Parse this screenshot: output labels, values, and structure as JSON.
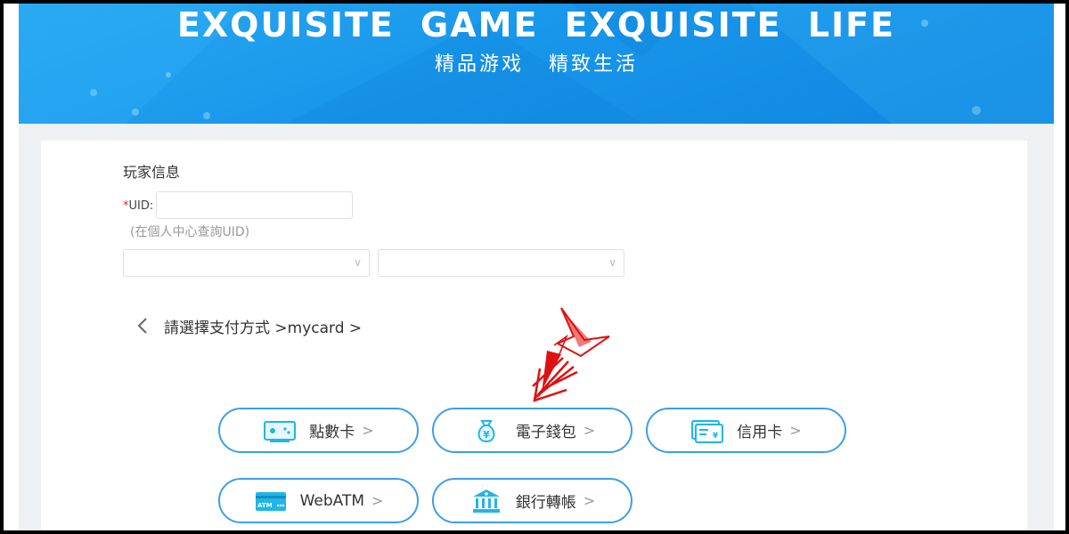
{
  "banner": {
    "title": "EXQUISITE GAME   EXQUISITE LIFE",
    "subtitle": "精品游戏   精致生活"
  },
  "player": {
    "section_title": "玩家信息",
    "uid_required_mark": "*",
    "uid_label": "UID:",
    "uid_value": "",
    "uid_hint": "(在個人中心查詢UID)",
    "select_1_value": "",
    "select_2_value": ""
  },
  "breadcrumb": {
    "text": "請選擇支付方式 >mycard >"
  },
  "payment_methods": [
    {
      "label": "點數卡",
      "icon": "game-card-icon"
    },
    {
      "label": "電子錢包",
      "icon": "money-bag-icon"
    },
    {
      "label": "信用卡",
      "icon": "credit-card-icon"
    },
    {
      "label": "WebATM",
      "icon": "atm-card-icon"
    },
    {
      "label": "銀行轉帳",
      "icon": "bank-icon"
    }
  ],
  "arrow_glyph": ">",
  "colors": {
    "banner_blue": "#1896ea",
    "button_border": "#3d9ee8",
    "icon_cyan": "#1fb6e8",
    "annotation_red": "#e01010"
  }
}
